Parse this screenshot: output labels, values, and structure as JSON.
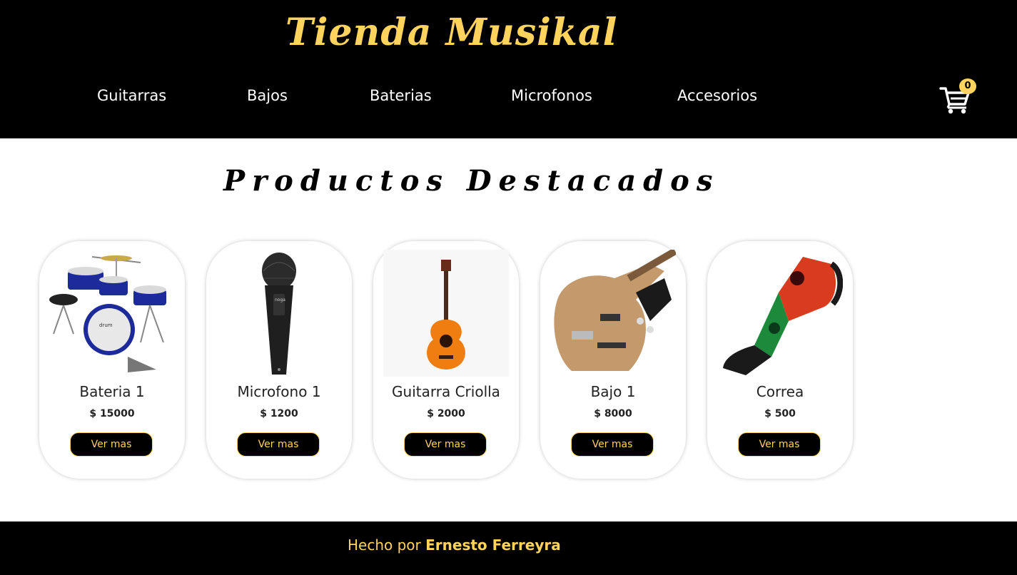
{
  "header": {
    "brand": "Tienda Musikal",
    "nav": [
      "Guitarras",
      "Bajos",
      "Baterias",
      "Microfonos",
      "Accesorios"
    ],
    "cart_count": "0",
    "cart_icon": "shopping-cart-icon"
  },
  "main": {
    "title": "Productos Destacados",
    "products": [
      {
        "name": "Bateria 1",
        "price": "$ 15000",
        "button": "Ver mas",
        "image": "drum-kit-image"
      },
      {
        "name": "Microfono 1",
        "price": "$ 1200",
        "button": "Ver mas",
        "image": "microphone-image"
      },
      {
        "name": "Guitarra Criolla",
        "price": "$ 2000",
        "button": "Ver mas",
        "image": "classical-guitar-image"
      },
      {
        "name": "Bajo 1",
        "price": "$ 8000",
        "button": "Ver mas",
        "image": "bass-guitar-image"
      },
      {
        "name": "Correa",
        "price": "$ 500",
        "button": "Ver mas",
        "image": "guitar-strap-image"
      }
    ]
  },
  "footer": {
    "prefix": "Hecho por",
    "author": "Ernesto Ferreyra"
  },
  "colors": {
    "accent": "#ffd35c",
    "header_bg": "#000000",
    "page_bg": "#ffffff"
  }
}
